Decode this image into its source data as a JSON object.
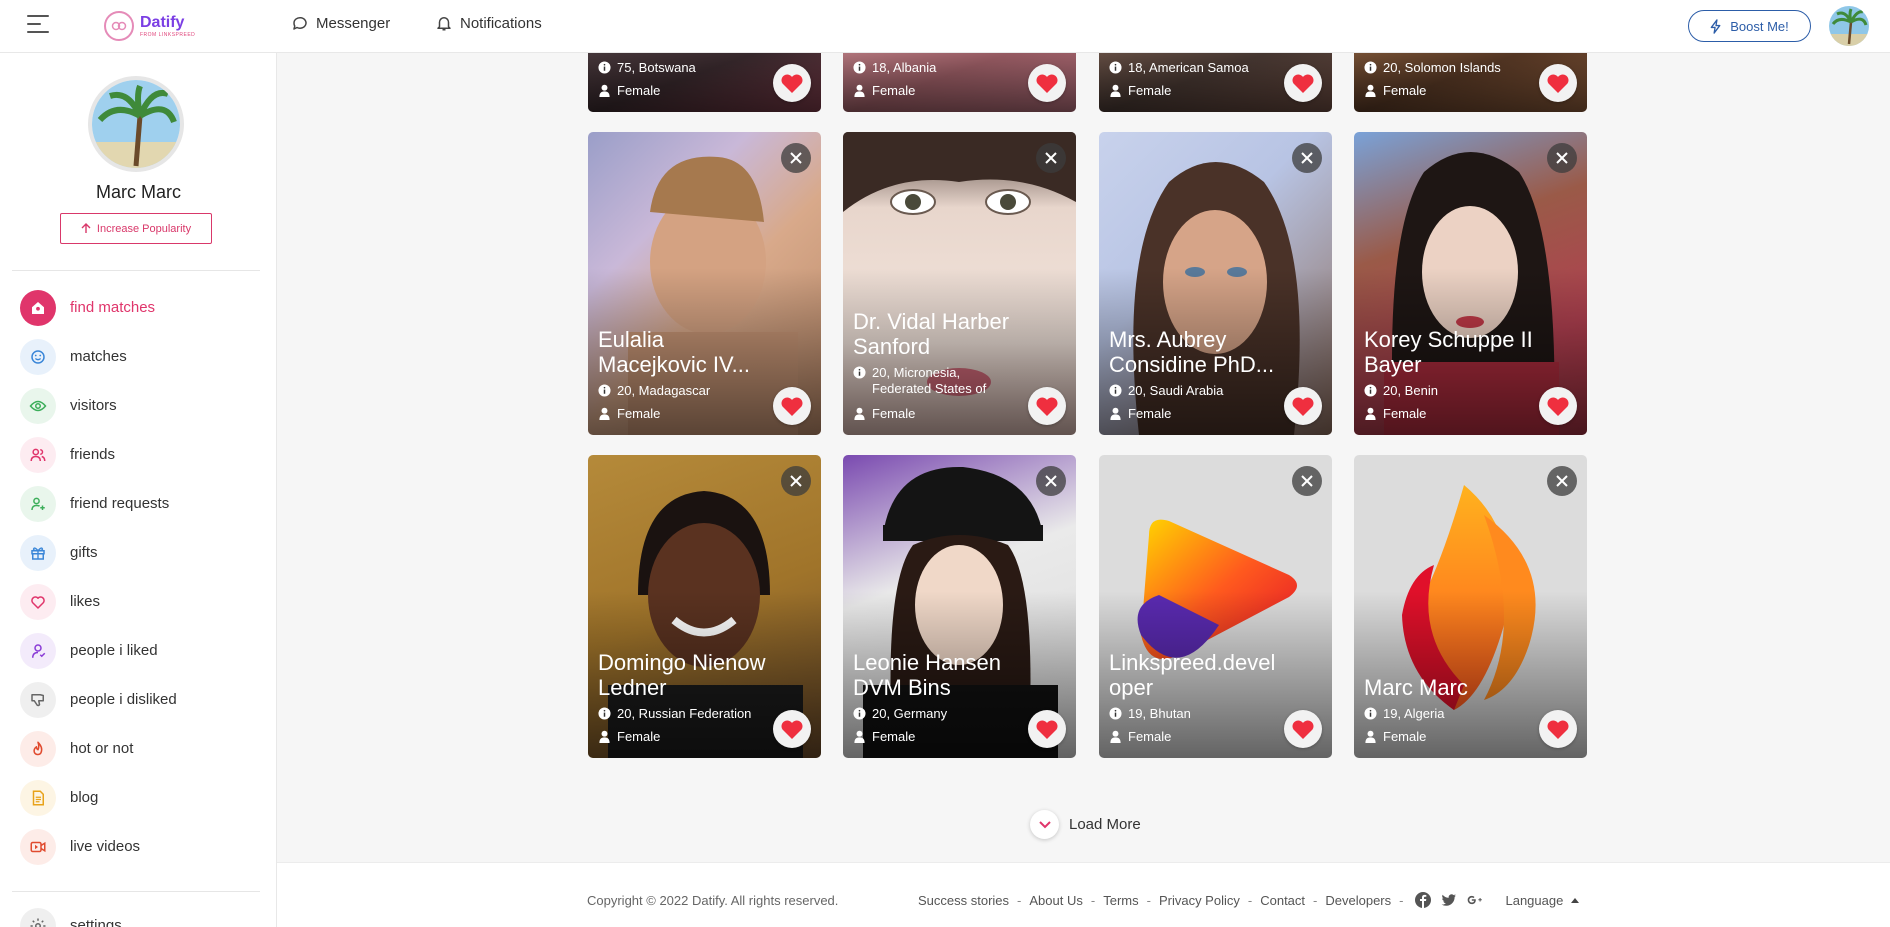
{
  "header": {
    "logo_name": "Datify",
    "logo_sub": "FROM LINKSPREED",
    "messenger": "Messenger",
    "notifications": "Notifications",
    "boost": "Boost Me!"
  },
  "sidebar": {
    "user_name": "Marc Marc",
    "popularity_button": "Increase Popularity",
    "items": [
      {
        "label": "find matches",
        "icon": "home-icon",
        "color": "#e0356b"
      },
      {
        "label": "matches",
        "icon": "smile-icon",
        "color": "#3a86d8"
      },
      {
        "label": "visitors",
        "icon": "eye-icon",
        "color": "#3cae5a"
      },
      {
        "label": "friends",
        "icon": "users-icon",
        "color": "#e0356b"
      },
      {
        "label": "friend requests",
        "icon": "user-plus-icon",
        "color": "#3cae5a"
      },
      {
        "label": "gifts",
        "icon": "gift-icon",
        "color": "#3a86d8"
      },
      {
        "label": "likes",
        "icon": "heart-icon",
        "color": "#e0356b"
      },
      {
        "label": "people i liked",
        "icon": "user-icon",
        "color": "#8a3bd6"
      },
      {
        "label": "people i disliked",
        "icon": "thumbs-down-icon",
        "color": "#666666"
      },
      {
        "label": "hot or not",
        "icon": "flame-icon",
        "color": "#e04a2e"
      },
      {
        "label": "blog",
        "icon": "document-icon",
        "color": "#e8a21a"
      },
      {
        "label": "live videos",
        "icon": "video-icon",
        "color": "#e04a2e"
      },
      {
        "label": "settings",
        "icon": "gear-icon",
        "color": "#666666"
      }
    ]
  },
  "cards_top": [
    {
      "info": "75, Botswana",
      "gender": "Female"
    },
    {
      "info": "18, Albania",
      "gender": "Female"
    },
    {
      "info": "18, American Samoa",
      "gender": "Female"
    },
    {
      "info": "20, Solomon Islands",
      "gender": "Female"
    }
  ],
  "cards_row2": [
    {
      "name": "Eulalia Macejkovic IV...",
      "info": "20, Madagascar",
      "gender": "Female"
    },
    {
      "name": "Dr. Vidal Harber Sanford",
      "info": "20, Micronesia, Federated States of",
      "gender": "Female"
    },
    {
      "name": "Mrs. Aubrey Considine PhD...",
      "info": "20, Saudi Arabia",
      "gender": "Female"
    },
    {
      "name": "Korey Schuppe II Bayer",
      "info": "20, Benin",
      "gender": "Female"
    }
  ],
  "cards_row3": [
    {
      "name": "Domingo Nienow Ledner",
      "info": "20, Russian Federation",
      "gender": "Female"
    },
    {
      "name": "Leonie Hansen DVM Bins",
      "info": "20, Germany",
      "gender": "Female"
    },
    {
      "name": "Linkspreed.developer",
      "info": "19, Bhutan",
      "gender": "Female"
    },
    {
      "name": "Marc Marc",
      "info": "19, Algeria",
      "gender": "Female"
    }
  ],
  "load_more": "Load More",
  "footer": {
    "copyright": "Copyright © 2022 Datify. All rights reserved.",
    "links": [
      "Success stories",
      "About Us",
      "Terms",
      "Privacy Policy",
      "Contact",
      "Developers"
    ],
    "language": "Language"
  }
}
